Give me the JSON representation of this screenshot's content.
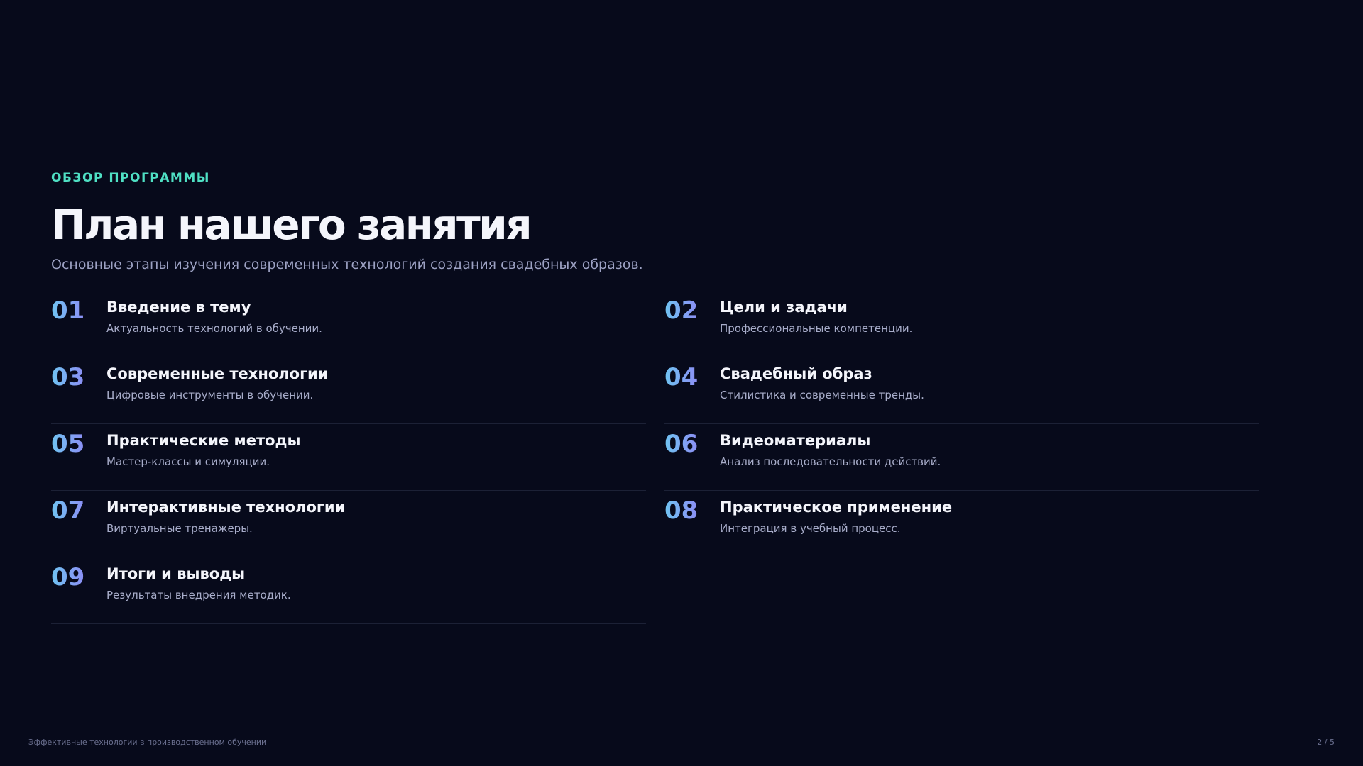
{
  "slide": {
    "eyebrow": "ОБЗОР ПРОГРАММЫ",
    "title": "План нашего занятия",
    "subtitle": "Основные этапы изучения современных технологий создания свадебных образов."
  },
  "items": [
    {
      "num": "01",
      "title": "Введение в тему",
      "desc": "Актуальность технологий в обучении."
    },
    {
      "num": "02",
      "title": "Цели и задачи",
      "desc": "Профессиональные компетенции."
    },
    {
      "num": "03",
      "title": "Современные технологии",
      "desc": "Цифровые инструменты в обучении."
    },
    {
      "num": "04",
      "title": "Свадебный образ",
      "desc": "Стилистика и современные тренды."
    },
    {
      "num": "05",
      "title": "Практические методы",
      "desc": "Мастер-классы и симуляции."
    },
    {
      "num": "06",
      "title": "Видеоматериалы",
      "desc": "Анализ последовательности действий."
    },
    {
      "num": "07",
      "title": "Интерактивные технологии",
      "desc": "Виртуальные тренажеры."
    },
    {
      "num": "08",
      "title": "Практическое применение",
      "desc": "Интеграция в учебный процесс."
    },
    {
      "num": "09",
      "title": "Итоги и выводы",
      "desc": "Результаты внедрения методик."
    }
  ],
  "footer": {
    "course_name": "Эффективные технологии в производственном обучении",
    "page_indicator": "2 / 5"
  },
  "colors": {
    "background": "#070a1b",
    "accent_eyebrow": "#4fe0c4",
    "number_gradient_start": "#6fc4f2",
    "number_gradient_end": "#8c8ef5"
  }
}
